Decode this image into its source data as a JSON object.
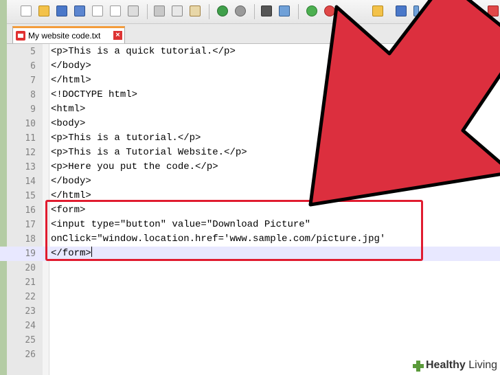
{
  "tab": {
    "title": "My website code.txt",
    "close": "×"
  },
  "editor": {
    "lines": [
      {
        "n": "5",
        "code": "<p>This is a quick tutorial.</p>"
      },
      {
        "n": "6",
        "code": "</body>"
      },
      {
        "n": "7",
        "code": "</html>"
      },
      {
        "n": "8",
        "code": "<!DOCTYPE html>"
      },
      {
        "n": "9",
        "code": "<html>"
      },
      {
        "n": "10",
        "code": "<body>"
      },
      {
        "n": "11",
        "code": "<p>This is a tutorial.</p>"
      },
      {
        "n": "12",
        "code": "<p>This is a Tutorial Website.</p>"
      },
      {
        "n": "13",
        "code": "<p>Here you put the code.</p>"
      },
      {
        "n": "14",
        "code": "</body>"
      },
      {
        "n": "15",
        "code": "</html>"
      },
      {
        "n": "16",
        "code": "<form>"
      },
      {
        "n": "17",
        "code": "<input type=\"button\" value=\"Download Picture\""
      },
      {
        "n": "18",
        "code": "onClick=\"window.location.href='www.sample.com/picture.jpg'"
      },
      {
        "n": "19",
        "code": "</form>"
      },
      {
        "n": "20",
        "code": ""
      },
      {
        "n": "21",
        "code": ""
      },
      {
        "n": "22",
        "code": ""
      },
      {
        "n": "23",
        "code": ""
      },
      {
        "n": "24",
        "code": ""
      },
      {
        "n": "25",
        "code": ""
      },
      {
        "n": "26",
        "code": ""
      }
    ]
  },
  "watermark": {
    "bold": "Healthy",
    "rest": " Living"
  },
  "colors": {
    "highlight": "#e01b2f",
    "arrow": "#dc2f3e",
    "current_line": "#e8e8ff"
  }
}
